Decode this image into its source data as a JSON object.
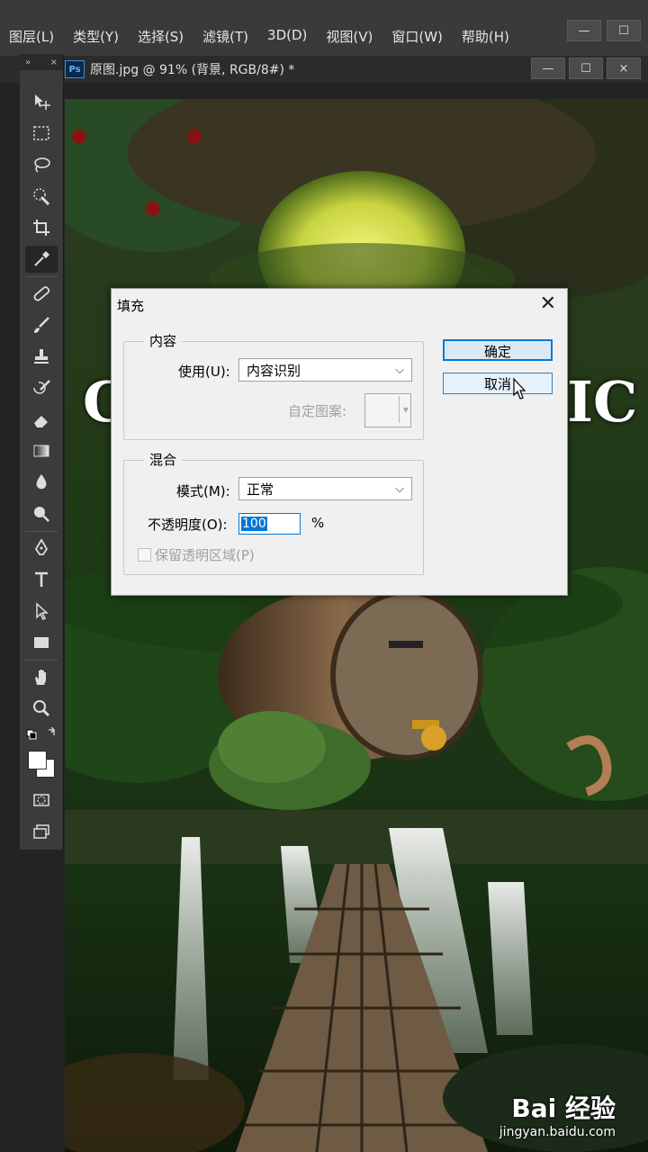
{
  "menubar": {
    "items": [
      "图层(L)",
      "类型(Y)",
      "选择(S)",
      "滤镜(T)",
      "3D(D)",
      "视图(V)",
      "窗口(W)",
      "帮助(H)"
    ],
    "window_buttons": [
      "—",
      "☐"
    ]
  },
  "toolbox": {
    "collapse": "»",
    "close": "×"
  },
  "document": {
    "badge": "Ps",
    "tab_title": "原图.jpg @ 91% (背景, RGB/8#) *",
    "buttons": [
      "—",
      "☐",
      "×"
    ]
  },
  "canvas": {
    "letters_left": "C",
    "letters_right": "IC"
  },
  "dialog": {
    "title": "填充",
    "close": "✕",
    "content_group": "内容",
    "use_label": "使用(U):",
    "use_value": "内容识别",
    "custom_pattern_label": "自定图案:",
    "blend_group": "混合",
    "mode_label": "模式(M):",
    "mode_value": "正常",
    "opacity_label": "不透明度(O):",
    "opacity_value": "100",
    "opacity_unit": "%",
    "preserve_label": "保留透明区域(P)",
    "ok_button": "确定",
    "cancel_button": "取消"
  },
  "watermark": {
    "logo": "Bai 经验",
    "url": "jingyan.baidu.com"
  }
}
